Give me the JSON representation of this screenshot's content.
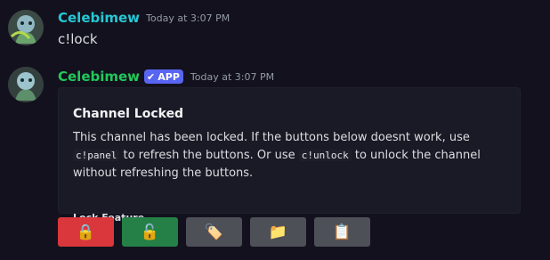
{
  "messages": [
    {
      "username": "Celebimew",
      "timestamp": "Today at 3:07 PM",
      "content": "c!lock"
    },
    {
      "username": "Celebimew",
      "badge": "APP",
      "timestamp": "Today at 3:07 PM",
      "embed": {
        "title": "Channel Locked",
        "desc_part1": "This channel has been locked. If the buttons below doesnt work, use ",
        "code1": "c!panel",
        "desc_part2": " to refresh the buttons. Or use ",
        "code2": "c!unlock",
        "desc_part3": " to unlock the channel without refreshing the buttons.",
        "footer": "Lock Feature"
      },
      "buttons": [
        {
          "icon": "lock-icon",
          "glyph": "🔒",
          "style": "danger"
        },
        {
          "icon": "unlock-icon",
          "glyph": "🔓",
          "style": "success"
        },
        {
          "icon": "tag-icon",
          "glyph": "🏷️",
          "style": "secondary"
        },
        {
          "icon": "folder-icon",
          "glyph": "📁",
          "style": "secondary"
        },
        {
          "icon": "clipboard-icon",
          "glyph": "📋",
          "style": "secondary"
        }
      ]
    }
  ],
  "colors": {
    "background": "#12111d",
    "username1": "#24c8d4",
    "username2": "#22c85a",
    "badge": "#5865f2",
    "danger": "#da373c",
    "success": "#248046",
    "secondary": "#4e5058"
  }
}
